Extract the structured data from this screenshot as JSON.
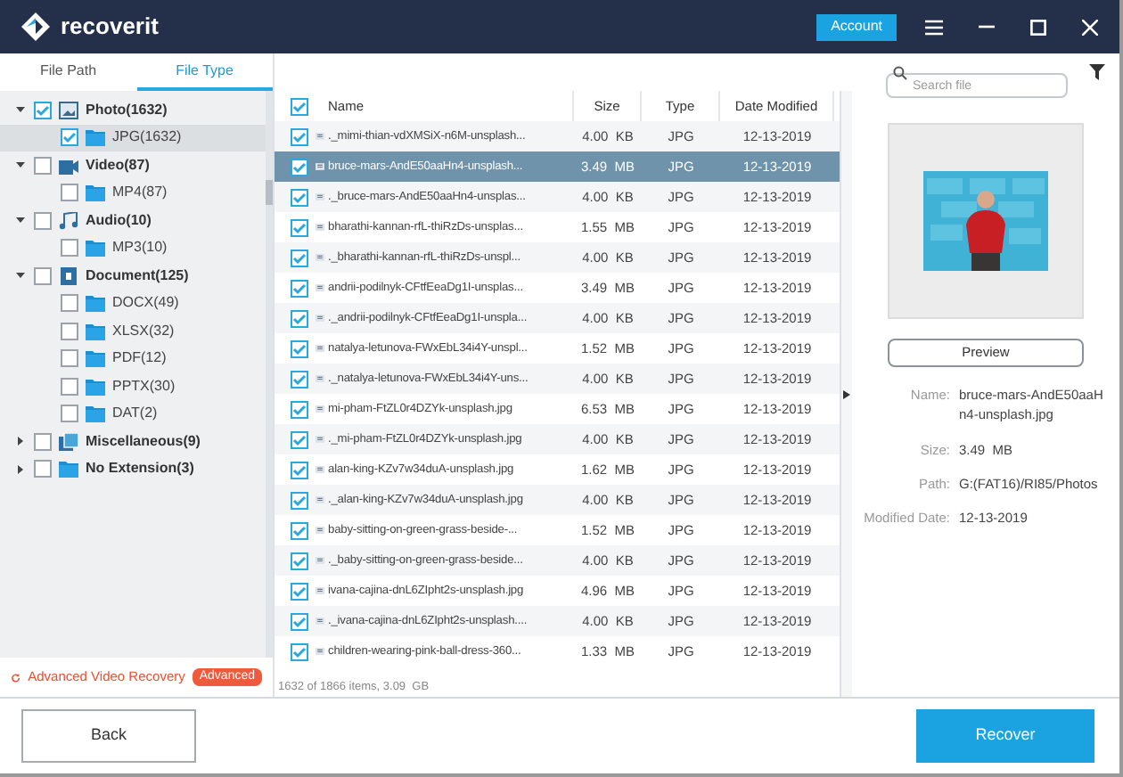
{
  "window": {
    "app_name": "recoverit",
    "account_button": "Account"
  },
  "left_tabs": [
    {
      "label": "File Path",
      "selected": false
    },
    {
      "label": "File Type",
      "selected": true
    }
  ],
  "tree": [
    {
      "label": "Photo(1632)",
      "checked": true,
      "expanded": true,
      "selected": false,
      "children": [
        {
          "label": "JPG(1632)",
          "kind": "folder",
          "checked": true,
          "selected": true
        }
      ]
    },
    {
      "label": "Video(87)",
      "kind": "video",
      "checked": false,
      "expanded": true,
      "selected": false,
      "children": [
        {
          "label": "MP4(87)",
          "kind": "folder",
          "checked": false,
          "selected": false
        }
      ]
    },
    {
      "label": "Audio(10)",
      "kind": "audio",
      "checked": false,
      "expanded": true,
      "selected": false,
      "children": [
        {
          "label": "MP3(10)",
          "kind": "folder",
          "checked": false,
          "selected": false
        }
      ]
    },
    {
      "label": "Document(125)",
      "kind": "document",
      "checked": false,
      "expanded": true,
      "selected": false,
      "children": [
        {
          "label": "DOCX(49)",
          "kind": "folder",
          "checked": false,
          "selected": false
        },
        {
          "label": "XLSX(32)",
          "kind": "folder",
          "checked": false,
          "selected": false
        },
        {
          "label": "PDF(12)",
          "kind": "folder",
          "checked": false,
          "selected": false
        },
        {
          "label": "PPTX(30)",
          "kind": "folder",
          "checked": false,
          "selected": false
        },
        {
          "label": "DAT(2)",
          "kind": "folder",
          "checked": false,
          "selected": false
        }
      ]
    },
    {
      "label": "Miscellaneous(9)",
      "kind": "misc",
      "checked": false,
      "expanded": false,
      "selected": false
    },
    {
      "label": "No Extension(3)",
      "kind": "folder",
      "checked": false,
      "expanded": false,
      "selected": false
    }
  ],
  "advanced_video": {
    "label": "Advanced Video Recovery",
    "badge": "Advanced"
  },
  "search": {
    "placeholder": "Search file"
  },
  "table": {
    "all_checked": true,
    "columns": [
      "Name",
      "Size",
      "Type",
      "Date Modified"
    ],
    "rows": [
      {
        "name": "._mimi-thian-vdXMSiX-n6M-unsplash...",
        "size": "4.00  KB",
        "type": "JPG",
        "date": "12-13-2019",
        "checked": true,
        "selected": false
      },
      {
        "name": "bruce-mars-AndE50aaHn4-unsplash...",
        "size": "3.49  MB",
        "type": "JPG",
        "date": "12-13-2019",
        "checked": true,
        "selected": true
      },
      {
        "name": "._bruce-mars-AndE50aaHn4-unsplas...",
        "size": "4.00  KB",
        "type": "JPG",
        "date": "12-13-2019",
        "checked": true,
        "selected": false
      },
      {
        "name": "bharathi-kannan-rfL-thiRzDs-unsplas...",
        "size": "1.55  MB",
        "type": "JPG",
        "date": "12-13-2019",
        "checked": true,
        "selected": false
      },
      {
        "name": "._bharathi-kannan-rfL-thiRzDs-unspl...",
        "size": "4.00  KB",
        "type": "JPG",
        "date": "12-13-2019",
        "checked": true,
        "selected": false
      },
      {
        "name": "andrii-podilnyk-CFtfEeaDg1I-unsplas...",
        "size": "3.49  MB",
        "type": "JPG",
        "date": "12-13-2019",
        "checked": true,
        "selected": false
      },
      {
        "name": "._andrii-podilnyk-CFtfEeaDg1I-unspla...",
        "size": "4.00  KB",
        "type": "JPG",
        "date": "12-13-2019",
        "checked": true,
        "selected": false
      },
      {
        "name": "natalya-letunova-FWxEbL34i4Y-unspl...",
        "size": "1.52  MB",
        "type": "JPG",
        "date": "12-13-2019",
        "checked": true,
        "selected": false
      },
      {
        "name": "._natalya-letunova-FWxEbL34i4Y-uns...",
        "size": "4.00  KB",
        "type": "JPG",
        "date": "12-13-2019",
        "checked": true,
        "selected": false
      },
      {
        "name": "mi-pham-FtZL0r4DZYk-unsplash.jpg",
        "size": "6.53  MB",
        "type": "JPG",
        "date": "12-13-2019",
        "checked": true,
        "selected": false
      },
      {
        "name": "._mi-pham-FtZL0r4DZYk-unsplash.jpg",
        "size": "4.00  KB",
        "type": "JPG",
        "date": "12-13-2019",
        "checked": true,
        "selected": false
      },
      {
        "name": "alan-king-KZv7w34duA-unsplash.jpg",
        "size": "1.62  MB",
        "type": "JPG",
        "date": "12-13-2019",
        "checked": true,
        "selected": false
      },
      {
        "name": "._alan-king-KZv7w34duA-unsplash.jpg",
        "size": "4.00  KB",
        "type": "JPG",
        "date": "12-13-2019",
        "checked": true,
        "selected": false
      },
      {
        "name": "baby-sitting-on-green-grass-beside-...",
        "size": "1.52  MB",
        "type": "JPG",
        "date": "12-13-2019",
        "checked": true,
        "selected": false
      },
      {
        "name": "._baby-sitting-on-green-grass-beside...",
        "size": "4.00  KB",
        "type": "JPG",
        "date": "12-13-2019",
        "checked": true,
        "selected": false
      },
      {
        "name": "ivana-cajina-dnL6ZIpht2s-unsplash.jpg",
        "size": "4.96  MB",
        "type": "JPG",
        "date": "12-13-2019",
        "checked": true,
        "selected": false
      },
      {
        "name": "._ivana-cajina-dnL6ZIpht2s-unsplash....",
        "size": "4.00  KB",
        "type": "JPG",
        "date": "12-13-2019",
        "checked": true,
        "selected": false
      },
      {
        "name": "children-wearing-pink-ball-dress-360...",
        "size": "1.33  MB",
        "type": "JPG",
        "date": "12-13-2019",
        "checked": true,
        "selected": false
      }
    ]
  },
  "status": "1632 of 1866 items, 3.09  GB",
  "details": {
    "preview_button": "Preview",
    "fields": [
      {
        "label": "Name:",
        "value": "bruce-mars-AndE50aaHn4-unsplash.jpg"
      },
      {
        "label": "Size:",
        "value": "3.49  MB"
      },
      {
        "label": "Path:",
        "value": "G:(FAT16)/RI85/Photos"
      },
      {
        "label": "Modified Date:",
        "value": "12-13-2019"
      }
    ]
  },
  "buttons": {
    "back": "Back",
    "recover": "Recover"
  }
}
